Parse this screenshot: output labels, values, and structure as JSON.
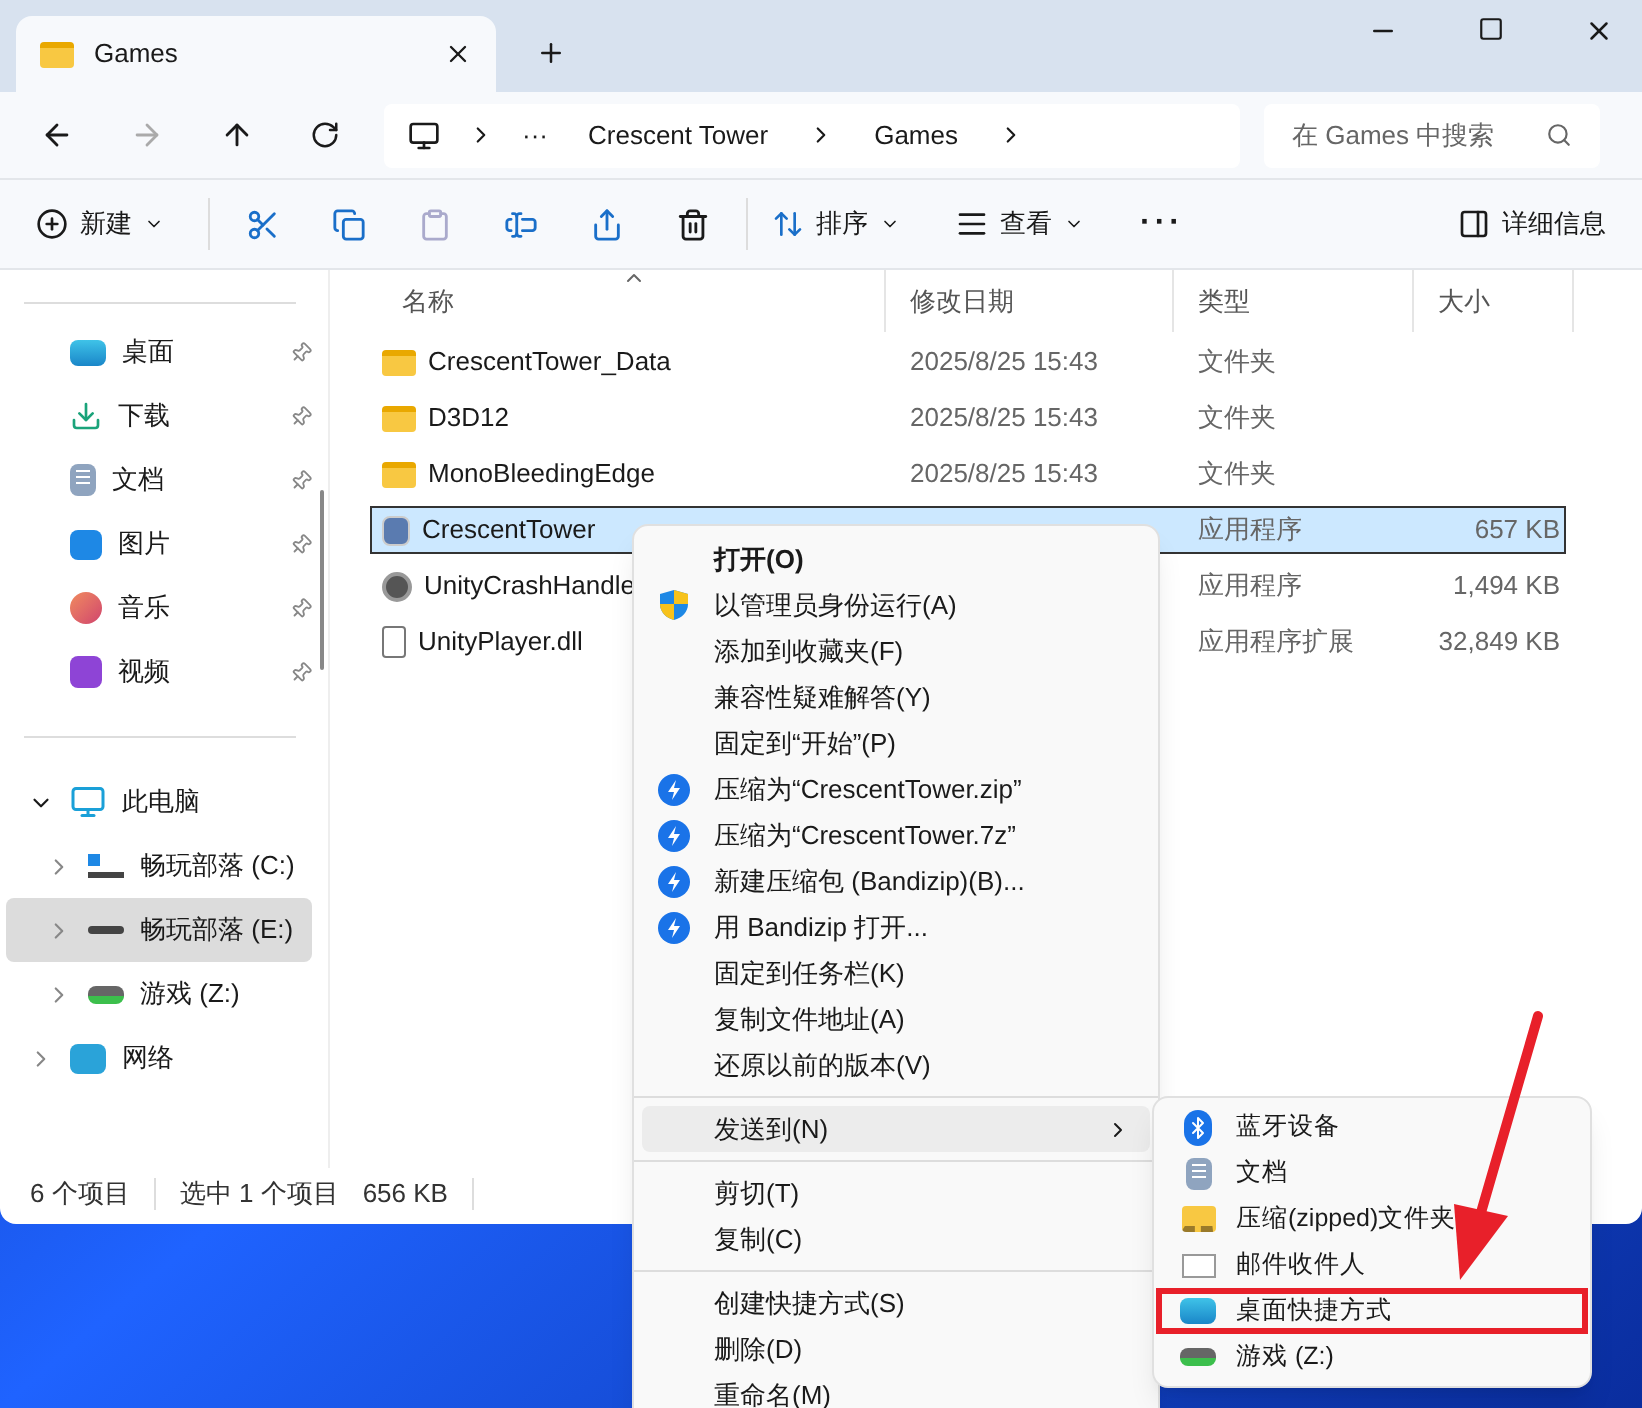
{
  "tabs": [
    {
      "title": "Games",
      "selected": true
    }
  ],
  "nav": {
    "more": "···",
    "breadcrumbs": [
      "Crescent Tower",
      "Games"
    ],
    "search_placeholder": "在 Games 中搜索"
  },
  "toolbar": {
    "new": "新建",
    "sort": "排序",
    "view": "查看",
    "details": "详细信息"
  },
  "sidebar": {
    "quick": [
      {
        "label": "桌面",
        "pinned": true
      },
      {
        "label": "下载",
        "pinned": true
      },
      {
        "label": "文档",
        "pinned": true
      },
      {
        "label": "图片",
        "pinned": true
      },
      {
        "label": "音乐",
        "pinned": true
      },
      {
        "label": "视频",
        "pinned": true
      }
    ],
    "tree": [
      {
        "label": "此电脑",
        "expanded": true,
        "selected": false,
        "children": [
          {
            "label": "畅玩部落 (C:)",
            "expanded": false,
            "selected": false
          },
          {
            "label": "畅玩部落 (E:)",
            "expanded": false,
            "selected": true
          },
          {
            "label": "游戏 (Z:)",
            "expanded": false,
            "selected": false
          }
        ]
      },
      {
        "label": "网络",
        "expanded": false,
        "selected": false
      }
    ]
  },
  "columns": [
    "名称",
    "修改日期",
    "类型",
    "大小"
  ],
  "rows": [
    {
      "name": "CrescentTower_Data",
      "date": "2025/8/25 15:43",
      "type": "文件夹",
      "kind": "folder",
      "selected": false
    },
    {
      "name": "D3D12",
      "date": "2025/8/25 15:43",
      "type": "文件夹",
      "kind": "folder",
      "selected": false
    },
    {
      "name": "MonoBleedingEdge",
      "date": "2025/8/25 15:43",
      "type": "文件夹",
      "kind": "folder",
      "selected": false
    },
    {
      "name": "CrescentTower",
      "type": "应用程序",
      "size": "657 KB",
      "kind": "app",
      "selected": true
    },
    {
      "name": "UnityCrashHandle",
      "type": "应用程序",
      "size": "1,494 KB",
      "kind": "unity",
      "selected": false
    },
    {
      "name": "UnityPlayer.dll",
      "type": "应用程序扩展",
      "size": "32,849 KB",
      "kind": "dll",
      "selected": false
    }
  ],
  "status_bar": [
    "6 个项目",
    "选中 1 个项目",
    "656 KB"
  ],
  "context_menu": [
    {
      "kind": "item",
      "label": "打开(O)",
      "default": true,
      "selected": false
    },
    {
      "kind": "admin",
      "label": "以管理员身份运行(A)",
      "default": false,
      "selected": false
    },
    {
      "kind": "item",
      "label": "添加到收藏夹(F)",
      "default": false,
      "selected": false
    },
    {
      "kind": "item",
      "label": "兼容性疑难解答(Y)",
      "default": false,
      "selected": false
    },
    {
      "kind": "item",
      "label": "固定到“开始”(P)",
      "default": false,
      "selected": false
    },
    {
      "kind": "archive",
      "label": "压缩为“CrescentTower.zip”",
      "default": false,
      "selected": false
    },
    {
      "kind": "archive",
      "label": "压缩为“CrescentTower.7z”",
      "default": false,
      "selected": false
    },
    {
      "kind": "archive",
      "label": "新建压缩包 (Bandizip)(B)...",
      "default": false,
      "selected": false
    },
    {
      "kind": "archive",
      "label": "用 Bandizip 打开...",
      "default": false,
      "selected": false
    },
    {
      "kind": "item",
      "label": "固定到任务栏(K)",
      "default": false,
      "selected": false
    },
    {
      "kind": "item",
      "label": "复制文件地址(A)",
      "default": false,
      "selected": false
    },
    {
      "kind": "item",
      "label": "还原以前的版本(V)",
      "default": false,
      "selected": false
    },
    {
      "kind": "separator"
    },
    {
      "kind": "submenu",
      "label": "发送到(N)",
      "default": false,
      "selected": true
    },
    {
      "kind": "separator"
    },
    {
      "kind": "item",
      "label": "剪切(T)",
      "default": false,
      "selected": false
    },
    {
      "kind": "item",
      "label": "复制(C)",
      "default": false,
      "selected": false
    },
    {
      "kind": "separator"
    },
    {
      "kind": "item",
      "label": "创建快捷方式(S)",
      "default": false,
      "selected": false
    },
    {
      "kind": "item",
      "label": "删除(D)",
      "default": false,
      "selected": false
    },
    {
      "kind": "item",
      "label": "重命名(M)",
      "default": false,
      "selected": false
    }
  ],
  "send_to": [
    {
      "label": "蓝牙设备",
      "highlighted": false
    },
    {
      "label": "文档",
      "highlighted": false
    },
    {
      "label": "压缩(zipped)文件夹",
      "highlighted": false
    },
    {
      "label": "邮件收件人",
      "highlighted": false
    },
    {
      "label": "桌面快捷方式",
      "highlighted": true
    },
    {
      "label": "游戏 (Z:)",
      "highlighted": false
    }
  ]
}
